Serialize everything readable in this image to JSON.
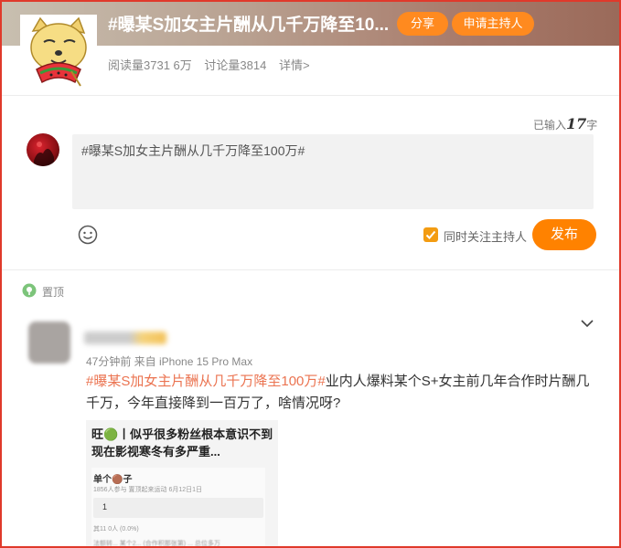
{
  "topic": {
    "title": "#曝某S加女主片酬从几千万降至10...",
    "share_label": "分享",
    "host_label": "申请主持人",
    "reads": "阅读量3731 6万",
    "discussions": "讨论量3814",
    "details": "详情>"
  },
  "composer": {
    "counter_prefix": "已输入",
    "counter_value": "17",
    "counter_suffix": "字",
    "text": "#曝某S加女主片酬从几千万降至100万#",
    "follow_host_label": "同时关注主持人",
    "publish_label": "发布"
  },
  "post": {
    "pin_label": "置顶",
    "meta": "47分钟前  来自 iPhone 15 Pro Max",
    "tag": "#曝某S加女主片酬从几千万降至100万#",
    "body": "业内人爆料某个S+女主前几年合作时片酬几千万，今年直接降到一百万了，啥情况呀?",
    "embed": {
      "title": "旺🟢丨似乎很多粉丝根本意识不到现在影视寒冬有多严重...",
      "card_title": "单个🟤子",
      "card_sub": "1856人参与  置顶起来运动  6月12日1日",
      "option": "1",
      "row1": "其11  0人 (0.0%)",
      "row2": "法额转... 某个2... (合作积那张第)  ... 总位多万"
    }
  },
  "colors": {
    "accent": "#ff8200",
    "hashtag": "#eb7350",
    "frame": "#e0392b"
  }
}
